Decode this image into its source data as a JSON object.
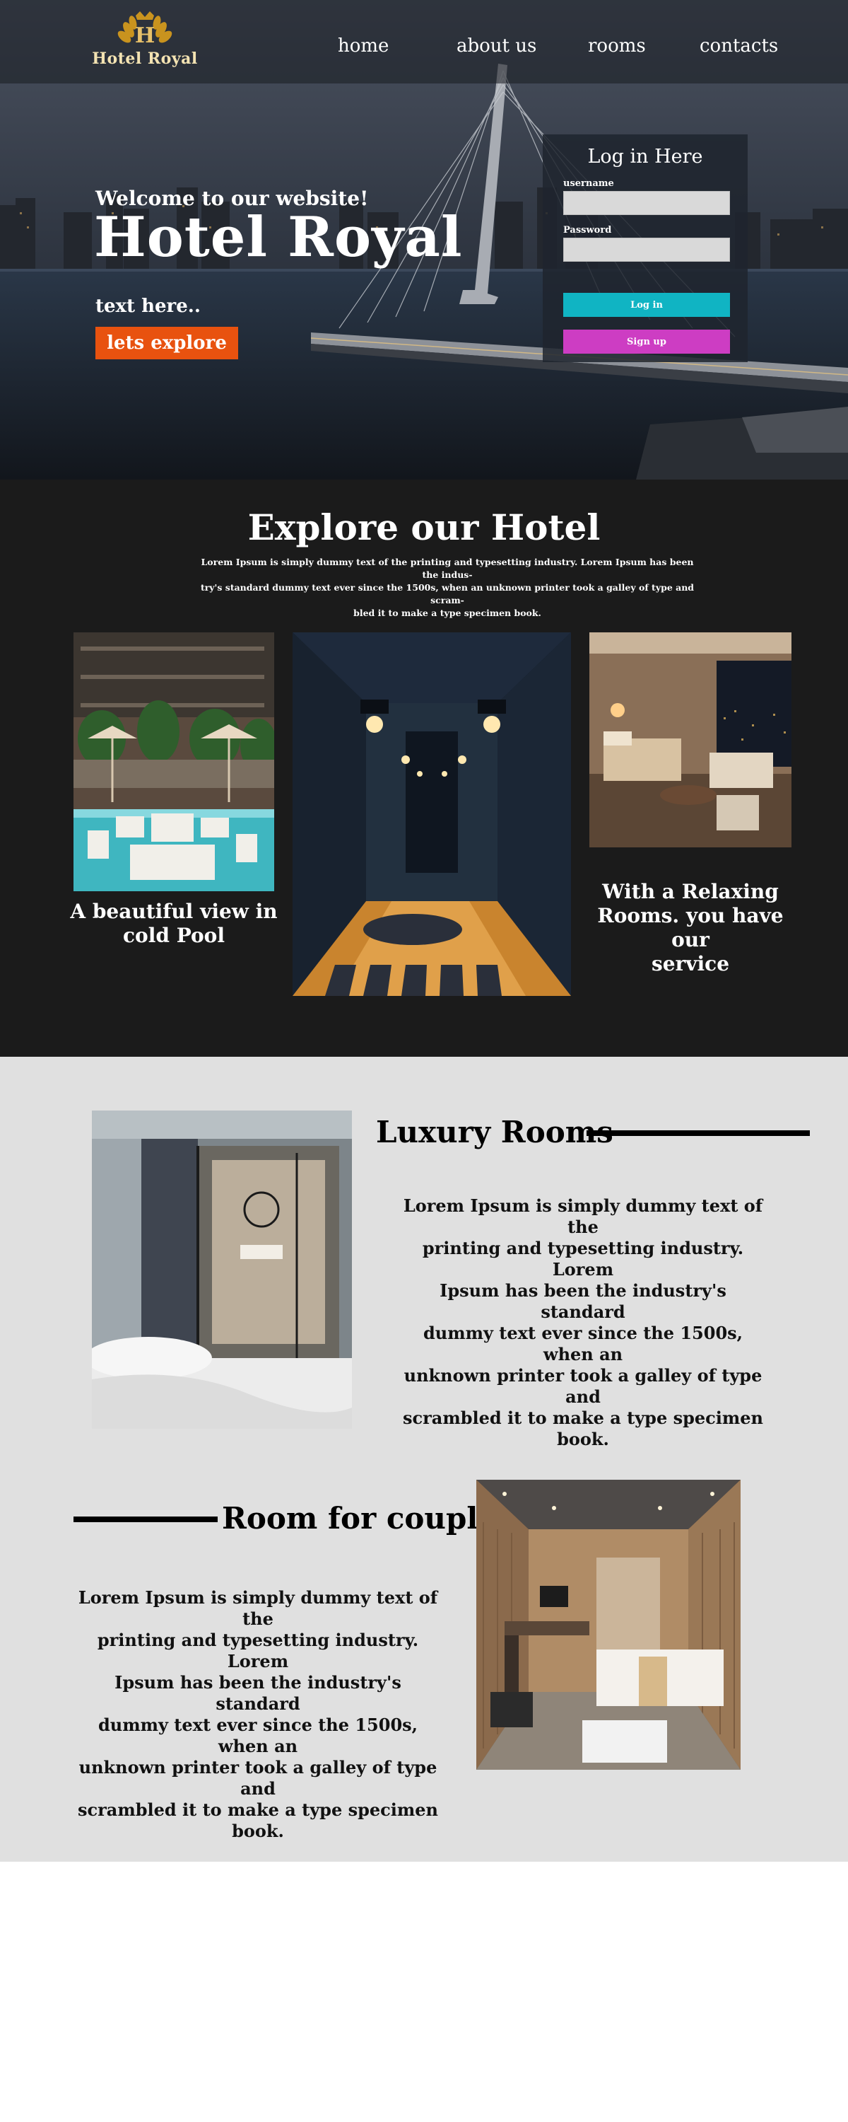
{
  "nav": {
    "logo_text": "Hotel Royal",
    "links": [
      "home",
      "about us",
      "rooms",
      "contacts"
    ]
  },
  "hero": {
    "welcome": "Welcome to our website!",
    "title": "Hotel Royal",
    "text": "text here..",
    "cta_label": "lets explore"
  },
  "login": {
    "title": "Log in Here",
    "username_label": "username",
    "password_label": "Password",
    "login_label": "Log in",
    "signup_label": "Sign up"
  },
  "explore": {
    "title": "Explore our Hotel",
    "description_lines": [
      "Lorem Ipsum is simply dummy text of the printing and typesetting industry. Lorem Ipsum has been the indus-",
      "try's standard dummy text ever since the 1500s, when an unknown printer took a galley of type and scram-",
      "bled it to make a type specimen book."
    ],
    "pool_caption_lines": [
      "A beautiful view in",
      "cold Pool"
    ],
    "room_caption_lines": [
      "With a Relaxing",
      "Rooms. you have our",
      "service"
    ]
  },
  "luxury": {
    "title": "Luxury Rooms",
    "text_lines": [
      "Lorem Ipsum is simply dummy text of the",
      "printing and typesetting industry. Lorem",
      "Ipsum has been the industry's standard",
      "dummy text ever since the 1500s, when an",
      "unknown printer took a galley of type and",
      "scrambled it to make a type specimen",
      "book."
    ]
  },
  "couples": {
    "title": "Room for couples",
    "text_lines": [
      "Lorem Ipsum is simply dummy text of the",
      "printing and typesetting industry. Lorem",
      "Ipsum has been the industry's standard",
      "dummy text ever since the 1500s, when an",
      "unknown printer took a galley of type and",
      "scrambled it to make a type specimen",
      "book."
    ]
  },
  "colors": {
    "accent_orange": "#e8520f",
    "login_teal": "#10b4c3",
    "signup_magenta": "#cd3dc3",
    "explore_bg": "#1b1b1b",
    "rooms_bg": "#e0e0e0"
  }
}
